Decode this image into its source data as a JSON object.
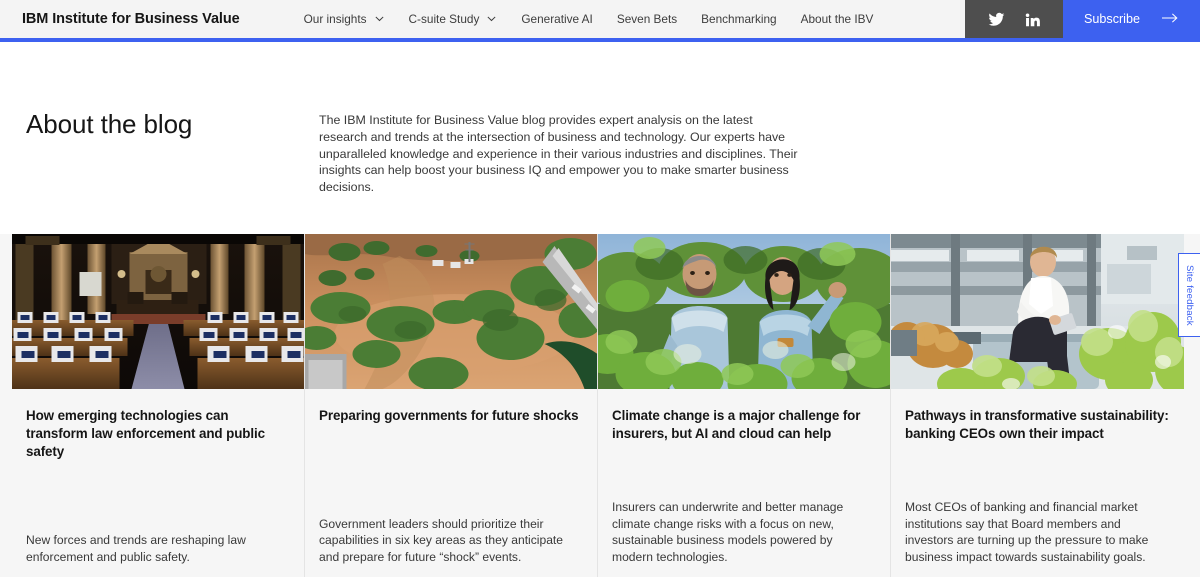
{
  "header": {
    "brand": "IBM Institute for Business Value",
    "nav_items": [
      {
        "label": "Our insights",
        "has_chevron": true,
        "icon": "chevron-down-icon"
      },
      {
        "label": "C-suite Study",
        "has_chevron": true,
        "icon": "chevron-down-icon"
      },
      {
        "label": "Generative AI",
        "has_chevron": false
      },
      {
        "label": "Seven Bets",
        "has_chevron": false
      },
      {
        "label": "Benchmarking",
        "has_chevron": false
      },
      {
        "label": "About the IBV",
        "has_chevron": false
      }
    ],
    "social": [
      {
        "name": "twitter-icon",
        "label": "Twitter"
      },
      {
        "name": "linkedin-icon",
        "label": "LinkedIn"
      }
    ],
    "subscribe_label": "Subscribe",
    "subscribe_icon": "arrow-right-icon",
    "accent_color": "#3d61f0",
    "social_bar_color": "#4e4e4e",
    "bar_color": "#f4f4f4"
  },
  "about": {
    "title": "About the blog",
    "body": "The IBM Institute for Business Value blog provides expert analysis on the latest research and trends at the intersection of business and technology. Our experts have unparalleled knowledge and experience in their various industries and disciplines. Their insights can help boost your business IQ and empower you to make smarter business decisions."
  },
  "cards": [
    {
      "title": "How emerging technologies can transform law enforcement and public safety",
      "description": "New forces and trends are reshaping law enforcement and public safety.",
      "image_alt": "legislative-chamber-with-desks-and-tablets"
    },
    {
      "title": "Preparing governments for future shocks",
      "description": "Government leaders should prioritize their capabilities in six key areas as they anticipate and prepare for future “shock” events.",
      "image_alt": "aerial-view-of-flooded-land-and-bridge"
    },
    {
      "title": "Climate change is a major challenge for insurers, but AI and cloud can help",
      "description": "Insurers can underwrite and better manage climate change risks with a focus on new, sustainable business models powered by modern technologies.",
      "image_alt": "two-people-inspecting-vineyard-foliage"
    },
    {
      "title": "Pathways in transformative sustainability: banking CEOs own their impact",
      "description": "Most CEOs of banking and financial market institutions say that Board members and investors are turning up the pressure to make business impact towards sustainability goals.",
      "image_alt": "man-with-tablet-sitting-outdoors-among-plants"
    }
  ],
  "feedback": {
    "label": "Site feedback"
  }
}
